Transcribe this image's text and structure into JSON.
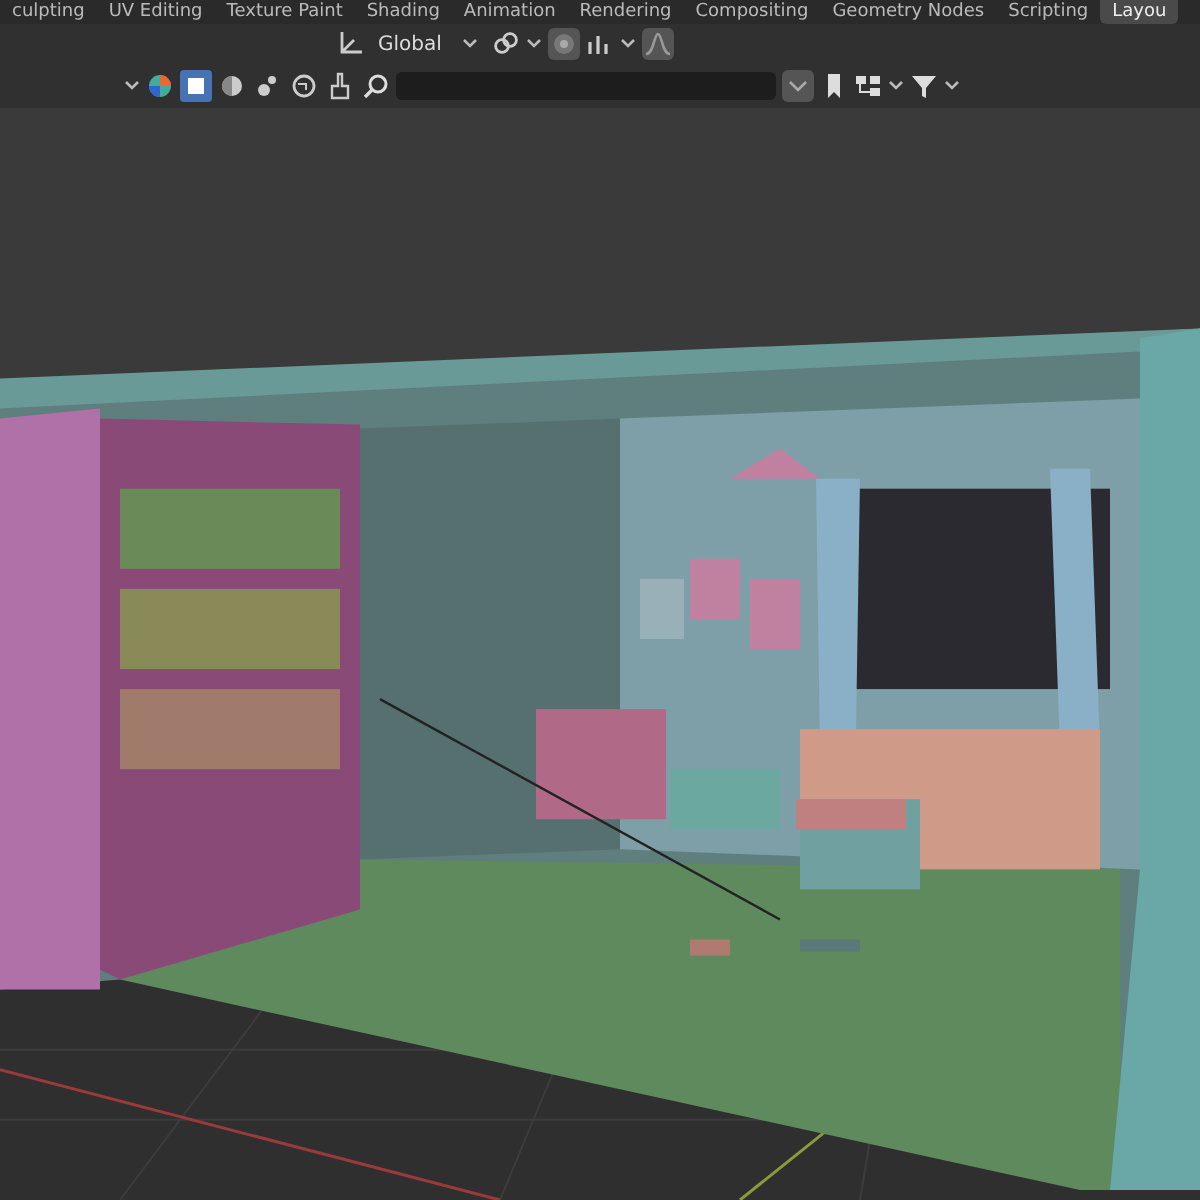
{
  "workspace_tabs": [
    {
      "label": "culpting",
      "selected": false
    },
    {
      "label": "UV Editing",
      "selected": false
    },
    {
      "label": "Texture Paint",
      "selected": false
    },
    {
      "label": "Shading",
      "selected": false
    },
    {
      "label": "Animation",
      "selected": false
    },
    {
      "label": "Rendering",
      "selected": false
    },
    {
      "label": "Compositing",
      "selected": false
    },
    {
      "label": "Geometry Nodes",
      "selected": false
    },
    {
      "label": "Scripting",
      "selected": false
    },
    {
      "label": "Layou",
      "selected": true
    }
  ],
  "viewport_header": {
    "orientation": "Global"
  },
  "outliner_filter": {
    "toggles": [
      {
        "kind": "box",
        "selected": true
      },
      {
        "kind": "sphere",
        "selected": false
      },
      {
        "kind": "light",
        "selected": false
      },
      {
        "kind": "world",
        "selected": false
      },
      {
        "kind": "brush",
        "selected": false
      }
    ]
  }
}
